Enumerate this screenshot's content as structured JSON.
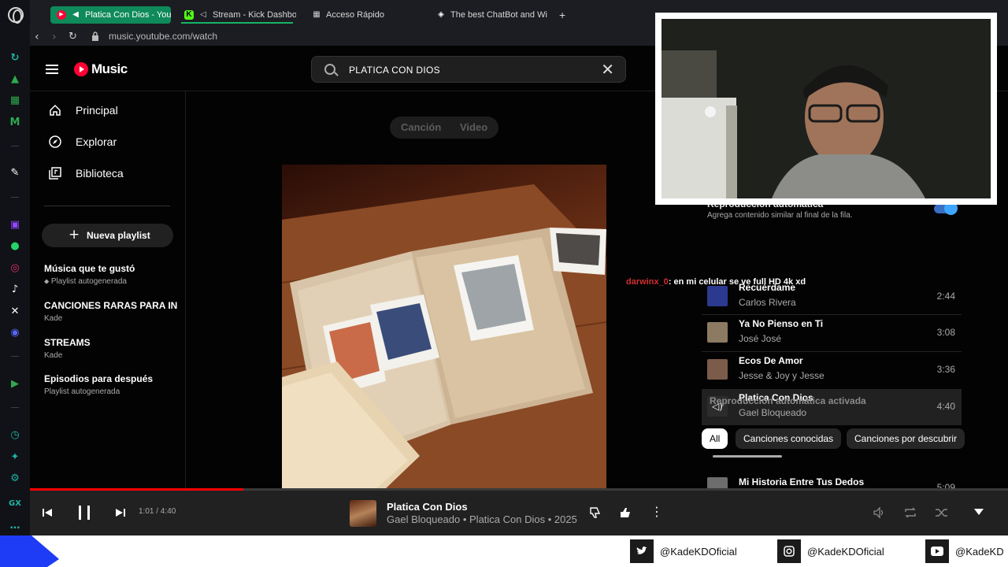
{
  "browser": {
    "tabs": [
      {
        "label": "Platica Con Dios - You"
      },
      {
        "label": "Stream - Kick Dashbo"
      },
      {
        "label": "Acceso Rápido"
      },
      {
        "label": "The best ChatBot and Wi"
      }
    ],
    "url": "music.youtube.com/watch"
  },
  "ytm": {
    "logo_text": "Music",
    "search_value": "PLATICA CON DIOS",
    "nav": [
      {
        "label": "Principal"
      },
      {
        "label": "Explorar"
      },
      {
        "label": "Biblioteca"
      }
    ],
    "new_playlist_label": "Nueva playlist",
    "playlists": [
      {
        "title": "Música que te gustó",
        "subtitle": "Playlist autogenerada"
      },
      {
        "title": "CANCIONES RARAS PARA IN...",
        "subtitle": "Kade"
      },
      {
        "title": "STREAMS",
        "subtitle": "Kade"
      },
      {
        "title": "Episodios para después",
        "subtitle": "Playlist autogenerada"
      }
    ],
    "segment": {
      "song": "Canción",
      "video": "Video"
    },
    "autoplay": {
      "title": "Reproducción automática",
      "subtitle": "Agrega contenido similar al final de la fila.",
      "enabled": true,
      "activated_label": "Reproducción automática activada"
    },
    "queue": [
      {
        "title": "Recuérdame",
        "artist": "Carlos Rivera",
        "duration": "2:44",
        "thumb_color": "#2b3a8f"
      },
      {
        "title": "Ya No Pienso en Ti",
        "artist": "José José",
        "duration": "3:08",
        "thumb_color": "#8c7a62"
      },
      {
        "title": "Ecos De Amor",
        "artist": "Jesse & Joy y Jesse",
        "duration": "3:36",
        "thumb_color": "#7b5b4a"
      },
      {
        "title": "Platica Con Dios",
        "artist": "Gael Bloqueado",
        "duration": "4:40",
        "thumb_color": "#2c2c2c"
      },
      {
        "title": "Mi Historia Entre Tus Dedos",
        "artist": "",
        "duration": "5:09",
        "thumb_color": "#6d6d6d"
      }
    ],
    "chips": [
      {
        "label": "All"
      },
      {
        "label": "Canciones conocidas"
      },
      {
        "label": "Canciones por descubrir"
      }
    ],
    "player": {
      "time": "1:01 / 4:40",
      "progress": 0.218,
      "title": "Platica Con Dios",
      "subtitle": "Gael Bloqueado • Platica Con Dios • 2025"
    }
  },
  "chat": {
    "user": "darwinx_0",
    "message": ": en mi celular se ve full HD 4k xd"
  },
  "social": [
    {
      "icon": "twitter-icon",
      "handle": "@KadeKDOficial"
    },
    {
      "icon": "instagram-icon",
      "handle": "@KadeKDOficial"
    },
    {
      "icon": "youtube-icon",
      "handle": "@KadeKD"
    }
  ],
  "colors": {
    "accent_red": "#ff0033",
    "toggle_blue": "#3ea6ff",
    "opera_green": "#0f8a5a"
  }
}
